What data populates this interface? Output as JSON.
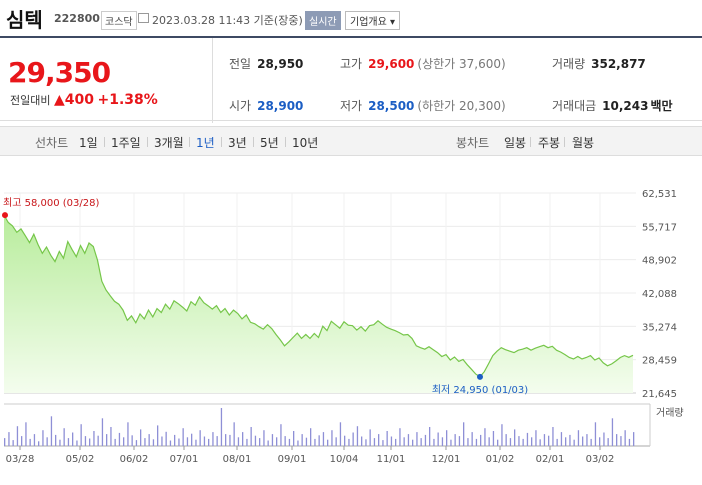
{
  "header": {
    "name": "심텍",
    "code": "222800",
    "market": "코스닥",
    "datetime": "2023.03.28 11:43 기준(장중)",
    "realtime_label": "실시간",
    "info_label": "기업개요 ▾"
  },
  "summary": {
    "price": "29,350",
    "change_label": "전일대비",
    "change_arrow": "▲",
    "change_amount": "400",
    "change_pct": "+1.38%",
    "prev_close": {
      "label": "전일",
      "value": "28,950"
    },
    "high": {
      "label": "고가",
      "value": "29,600",
      "sub": "(상한가 37,600)"
    },
    "volume": {
      "label": "거래량",
      "value": "352,877"
    },
    "open": {
      "label": "시가",
      "value": "28,900"
    },
    "low": {
      "label": "저가",
      "value": "28,500",
      "sub": "(하한가 20,300)"
    },
    "trade_value": {
      "label": "거래대금",
      "value": "10,243",
      "unit": "백만"
    }
  },
  "tabs": {
    "line_label": "선차트",
    "line_items": [
      "1일",
      "1주일",
      "3개월",
      "1년",
      "3년",
      "5년",
      "10년"
    ],
    "line_selected": "1년",
    "candle_label": "봉차트",
    "candle_items": [
      "일봉",
      "주봉",
      "월봉"
    ]
  },
  "chart_data": {
    "type": "area",
    "y_ticks": [
      "62,531",
      "55,717",
      "48,902",
      "42,088",
      "35,274",
      "28,459",
      "21,645"
    ],
    "ylim": [
      21645,
      62531
    ],
    "x_ticks": [
      "03/28",
      "05/02",
      "06/02",
      "07/01",
      "08/01",
      "09/01",
      "10/04",
      "11/01",
      "12/01",
      "01/02",
      "02/01",
      "03/02"
    ],
    "high_annotation": "최고 58,000 (03/28)",
    "low_annotation": "최저 24,950 (01/03)",
    "high": 58000,
    "low": 24950,
    "volume_legend": "거래량",
    "series": [
      {
        "values": [
          58000,
          56500,
          55800,
          54500,
          55200,
          53800,
          52400,
          54100,
          52000,
          50200,
          51500,
          49800,
          48500,
          50600,
          49200,
          52600,
          51000,
          49500,
          51800,
          50200,
          52300,
          51600,
          48800,
          44500,
          42700,
          41500,
          40400,
          39800,
          38600,
          36500,
          37400,
          36000,
          37800,
          36800,
          38600,
          37200,
          38900,
          38100,
          39800,
          38800,
          40500,
          39900,
          39200,
          38400,
          40300,
          39600,
          41300,
          40100,
          39500,
          38800,
          39500,
          38100,
          38900,
          37600,
          38600,
          37900,
          36800,
          37600,
          36100,
          35800,
          35200,
          34700,
          35600,
          34800,
          33600,
          32500,
          31300,
          32100,
          33000,
          33900,
          32800,
          33600,
          32800,
          33800,
          33000,
          35300,
          34400,
          36300,
          35600,
          34900,
          36200,
          35500,
          35400,
          34500,
          35200,
          34300,
          35400,
          35600,
          36400,
          35700,
          35100,
          34700,
          34400,
          34000,
          33500,
          33600,
          32800,
          31300,
          30900,
          30600,
          31100,
          30500,
          29900,
          29100,
          29500,
          28400,
          29000,
          28100,
          28500,
          27400,
          26500,
          25500,
          24950,
          26000,
          27600,
          29300,
          30200,
          30900,
          30500,
          30200,
          29900,
          30400,
          30600,
          30900,
          30400,
          30800,
          31100,
          31400,
          30900,
          31200,
          30400,
          30000,
          29500,
          28900,
          28600,
          29100,
          28600,
          28900,
          29300,
          28400,
          28800,
          27800,
          27200,
          27600,
          28200,
          28900,
          29300,
          28950,
          29350
        ]
      }
    ],
    "volume": [
      20,
      35,
      15,
      50,
      25,
      60,
      18,
      30,
      12,
      40,
      22,
      75,
      28,
      16,
      45,
      20,
      34,
      14,
      55,
      25,
      19,
      38,
      26,
      70,
      30,
      48,
      18,
      33,
      22,
      60,
      27,
      15,
      42,
      20,
      30,
      17,
      52,
      24,
      36,
      14,
      28,
      19,
      45,
      22,
      31,
      16,
      40,
      24,
      18,
      35,
      25,
      96,
      30,
      28,
      60,
      22,
      35,
      18,
      48,
      26,
      20,
      40,
      14,
      30,
      22,
      55,
      25,
      18,
      38,
      14,
      30,
      21,
      45,
      18,
      27,
      35,
      16,
      40,
      22,
      60,
      26,
      18,
      34,
      50,
      24,
      17,
      42,
      20,
      30,
      15,
      38,
      24,
      18,
      45,
      22,
      30,
      16,
      35,
      20,
      28,
      48,
      18,
      34,
      22,
      40,
      16,
      30,
      25,
      60,
      20,
      35,
      18,
      28,
      45,
      22,
      38,
      16,
      55,
      30,
      20,
      42,
      25,
      18,
      33,
      22,
      40,
      17,
      30,
      26,
      48,
      18,
      35,
      22,
      28,
      16,
      40,
      24,
      30,
      18,
      60,
      22,
      34,
      20,
      70,
      30,
      25,
      40,
      18,
      35
    ]
  }
}
